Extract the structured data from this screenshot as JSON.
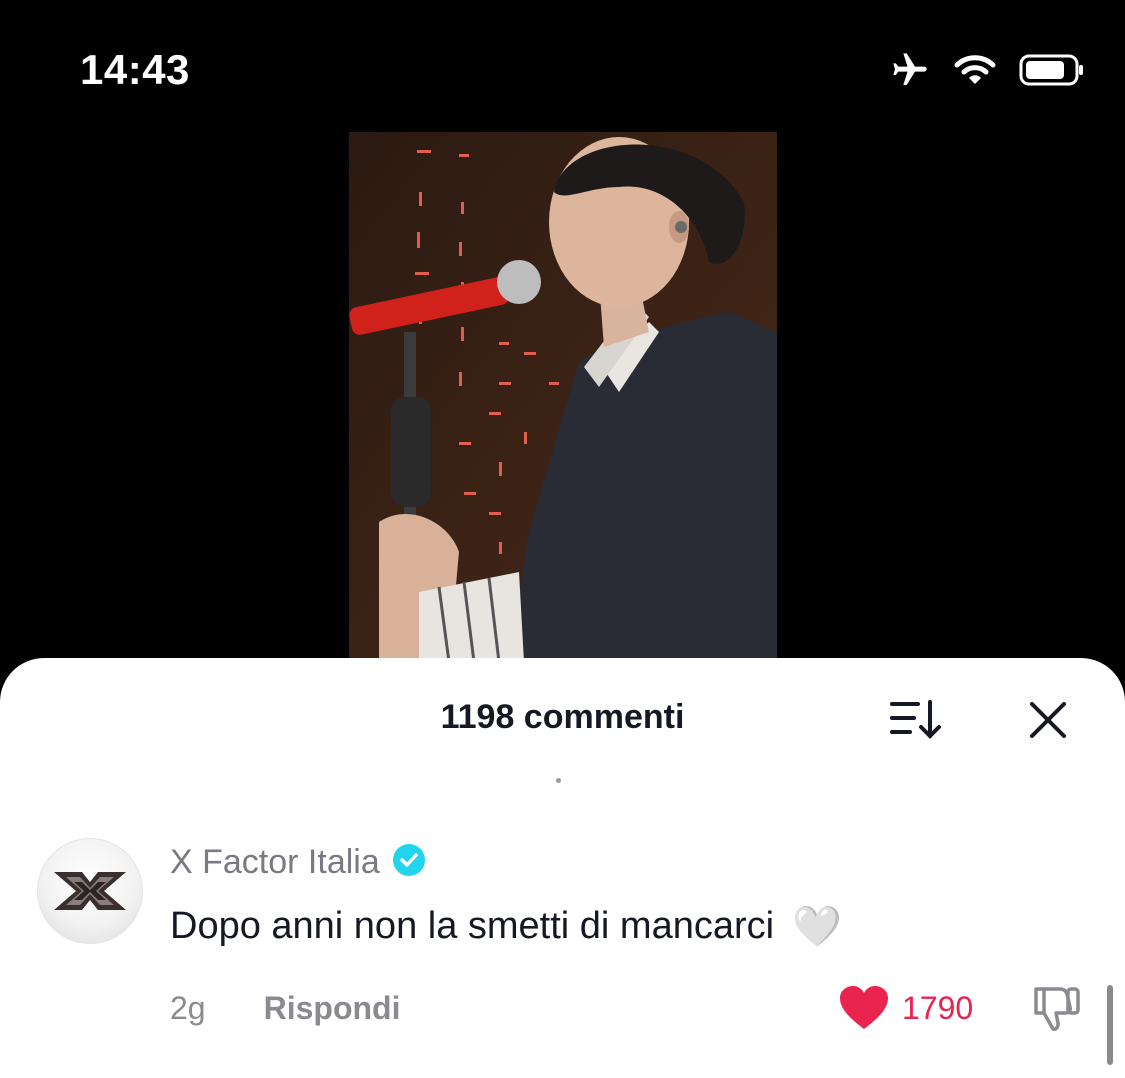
{
  "status_bar": {
    "time": "14:43",
    "icons": [
      "airplane-icon",
      "wifi-icon",
      "battery-icon"
    ]
  },
  "video": {
    "description_icon": "video-frame"
  },
  "comments_sheet": {
    "header": {
      "title": "1198 commenti",
      "sort_icon": "sort-icon",
      "close_icon": "close-icon"
    },
    "comments": [
      {
        "author": "X Factor Italia",
        "verified": true,
        "text": "Dopo anni non la smetti di mancarci",
        "emoji": "🤍",
        "age": "2g",
        "reply_label": "Rispondi",
        "likes": "1790",
        "liked": true
      }
    ]
  },
  "colors": {
    "like": "#e8244f",
    "verified": "#20d5ec",
    "text_primary": "#161823",
    "text_secondary": "#8a8b91"
  }
}
